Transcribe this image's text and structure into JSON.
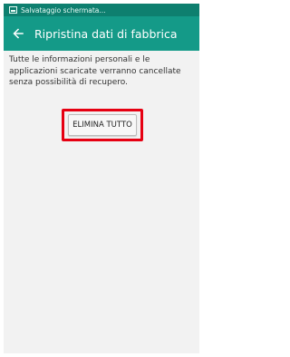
{
  "status_bar": {
    "notification_text": "Salvataggio schermata...",
    "icon": "screenshot-icon",
    "color": "#0e7f6f"
  },
  "app_bar": {
    "title": "Ripristina dati di fabbrica",
    "back_icon": "arrow-left-icon",
    "color": "#149a88"
  },
  "main": {
    "description": "Tutte le informazioni personali e le applicazioni scaricate verranno cancellate senza possibilità di recupero.",
    "erase_button_label": "ELIMINA TUTTO",
    "highlight_color": "#e60012"
  }
}
